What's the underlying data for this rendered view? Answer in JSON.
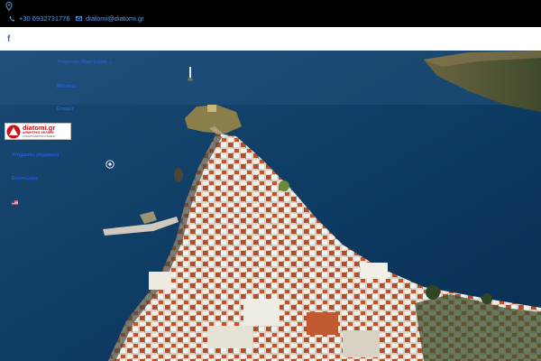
{
  "topbar": {
    "phone": "+30 6932731776",
    "email": "diatomi@diatomi.gr",
    "pin_icon": "map-pin-icon",
    "phone_icon": "phone-icon",
    "email_icon": "envelope-icon"
  },
  "socialbar": {
    "facebook_glyph": "f",
    "facebook_icon": "facebook-icon"
  },
  "nav": {
    "items": [
      {
        "label": "Υπηρεσίες Real Estate",
        "has_dropdown": true
      },
      {
        "label": "Μουσεία"
      },
      {
        "label": "Επαφές"
      },
      {
        "label": "Υπηρεσίες μηχανικού"
      },
      {
        "label": "Εντυπώσεις"
      }
    ],
    "language_flag_icon": "us-flag-icon"
  },
  "logo": {
    "brand": "diatomi.gr",
    "subtitle": "ΔΗΜΗΤΡΗΣ ΧΕΛΜΗΣ",
    "tagline": "ΚΤΗΜΑΤΟΜΕΣΙΤΙΚΟ ΓΡΑΦΕΙΟ"
  },
  "colors": {
    "topbar": "#000000",
    "link": "#2d63ff",
    "contact": "#5aa0e6",
    "sea": "#0d3d64",
    "logo_red": "#c8131a"
  }
}
